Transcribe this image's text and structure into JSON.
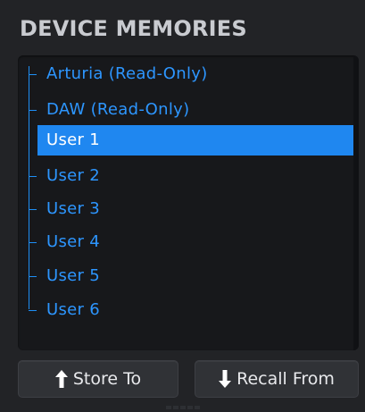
{
  "panel": {
    "title": "DEVICE MEMORIES"
  },
  "memories": {
    "items": [
      {
        "label": "Arturia (Read-Only)",
        "selected": false
      },
      {
        "label": "DAW (Read-Only)",
        "selected": false
      },
      {
        "label": "User 1",
        "selected": true
      },
      {
        "label": "User 2",
        "selected": false
      },
      {
        "label": "User 3",
        "selected": false
      },
      {
        "label": "User 4",
        "selected": false
      },
      {
        "label": "User 5",
        "selected": false
      },
      {
        "label": "User 6",
        "selected": false
      }
    ]
  },
  "buttons": {
    "store_label": "Store To",
    "recall_label": "Recall From",
    "store_icon": "arrow-up-icon",
    "recall_icon": "arrow-down-icon"
  },
  "colors": {
    "accent": "#1f87f0",
    "item_text": "#2d96ff",
    "background": "#222326"
  }
}
